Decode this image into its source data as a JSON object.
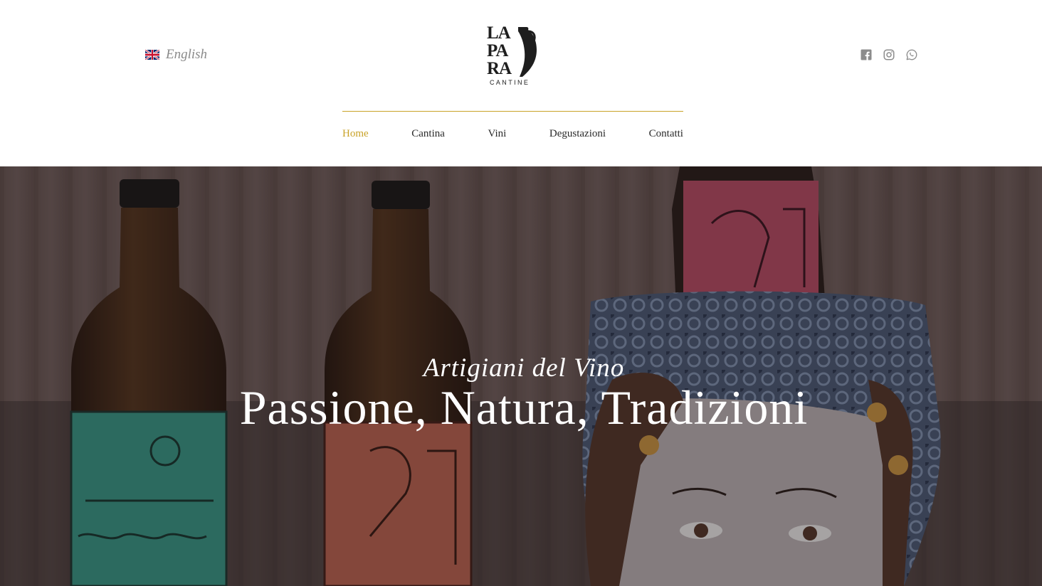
{
  "header": {
    "language": {
      "label": "English",
      "flag_icon": "uk-flag-icon"
    },
    "logo": {
      "lines": [
        "LA",
        "PA",
        "RA"
      ],
      "subtitle": "CANTINE"
    },
    "social": [
      {
        "name": "facebook-icon"
      },
      {
        "name": "instagram-icon"
      },
      {
        "name": "whatsapp-icon"
      }
    ]
  },
  "nav": {
    "items": [
      {
        "label": "Home",
        "active": true
      },
      {
        "label": "Cantina",
        "active": false
      },
      {
        "label": "Vini",
        "active": false
      },
      {
        "label": "Degustazioni",
        "active": false
      },
      {
        "label": "Contatti",
        "active": false
      }
    ]
  },
  "hero": {
    "subtitle": "Artigiani del Vino",
    "title": "Passione, Natura, Tradizioni"
  },
  "colors": {
    "accent": "#c9a227",
    "text": "#2a2a2a",
    "muted": "#8a8a8a",
    "icon": "#8c8c8c"
  }
}
